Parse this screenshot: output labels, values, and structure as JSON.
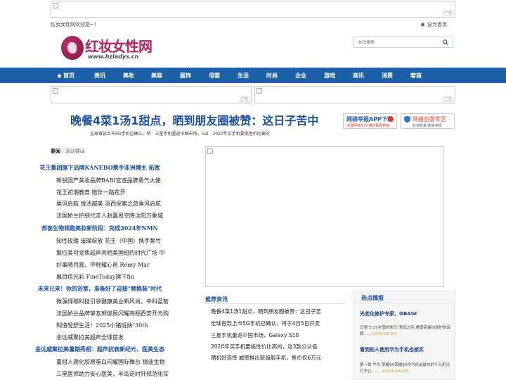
{
  "site": {
    "welcome": "红妆女性网欢迎您~！",
    "set_home": "设为首页",
    "logo_cn": "红妆女性网",
    "logo_en": "www.hzladys.cn"
  },
  "ads": {
    "tag": "广告"
  },
  "search": {
    "placeholder": "本站搜索"
  },
  "nav": {
    "items": [
      "首页",
      "资讯",
      "美妆",
      "美容",
      "服饰",
      "母婴",
      "生活",
      "时尚",
      "企业",
      "游戏",
      "商讯",
      "消费",
      "奢商"
    ]
  },
  "headline": {
    "title": "晚餐4菜1汤1甜点，晒到朋友圈被赞：这日子苦中",
    "subtitle": "全球首款上市5G手机已确认，将　三星手机重返中国市场，Gal　2020年买手机要挑性价比高的"
  },
  "badges": {
    "app_title": "网络举报APP下载",
    "app_sub": "清理网络空间 维护网民权益",
    "zone_title": "网络监督专区",
    "zone_sub": "欢迎监督 能获举报"
  },
  "news": {
    "title": "要闻",
    "sep": "|",
    "scroll": "滚动要闻",
    "items": [
      {
        "text": "花王集团旗下品牌KANEBO携手亚洲博主 拓宽",
        "highlight": true
      },
      {
        "text": "新锐国产美妆品牌BABI官宣品牌勇气大使",
        "highlight": false
      },
      {
        "text": "花王初潮教育 陪伴一路花开",
        "highlight": false
      },
      {
        "text": "乘风启航 悦活越美 羽西探索之旅乘风启航",
        "highlight": false
      },
      {
        "text": "法国娇兰护肤代言人赵露思空降沈阳万象城",
        "highlight": false
      },
      {
        "text": "邦泰生物领跑美妆新阶段：完成2024年NMN",
        "highlight": true
      },
      {
        "text": "知性玫瑰 璀璨绽放 花王（中国）携手紫竹",
        "highlight": false
      },
      {
        "text": "聚拉美可变焦超声亮相美国纽约时代广场 中",
        "highlight": false
      },
      {
        "text": "好事随月圆，中秋耀心邑 Rémy Mar",
        "highlight": false
      },
      {
        "text": "展目信光彩 FineToday旗下fin",
        "highlight": false
      },
      {
        "text": "未来已来！你的浴室，准备好了迎接\"替换装\"时代",
        "highlight": true
      },
      {
        "text": "微藻绿碳科技引领健康美业新风尚，中科蓝智",
        "highlight": false
      },
      {
        "text": "法国娇兰品牌挚友郭俊辰闪耀亮相西安开元购",
        "highlight": false
      },
      {
        "text": "制造轻舒生活！2025小猪班纳\"30th",
        "highlight": false
      },
      {
        "text": "金达威聚拉美超声全球首发",
        "highlight": false
      },
      {
        "text": "金达威聚拉美暑期秀相：超声抗衰新纪元，医美生态",
        "highlight": true
      },
      {
        "text": "重组人源化胶原蛋白闪耀国际舞台 锦波生物",
        "highlight": false
      },
      {
        "text": "三星医师助力安心医美，半岛逆时针规范化实",
        "highlight": false
      }
    ]
  },
  "recommend": {
    "title": "推荐资讯",
    "items": [
      "晚餐4菜1汤1甜点，晒到朋友圈被赞：这日子苦",
      "全球首款上市5G手机已确认，将于4月5日开卖",
      "三星手机重返中国市场，Galaxy S10",
      "2020年买手机要挑性价比高的，这3款公认值",
      "晒机好选择 威图推出新旗舰手机，售价仅6万元"
    ]
  },
  "hot": {
    "title": "热点播报",
    "items": [
      {
        "head": "光老化修护专家，OBAGI",
        "body": "正值\"5.25全国护肤日\"来临之际,美国高端功效护肤品牌……",
        "date": "[2020-05-20]"
      },
      {
        "head": "看到别人使用华为手机也想买",
        "body": "第一款 华为 荣耀9X荣耀9X作为目前最热的千元机当仁不让，……",
        "date": "[2020-04-20]"
      }
    ]
  },
  "colors": {
    "nav_bg": "#1c5fa8",
    "accent_blue": "#1a4f9c",
    "brand_magenta": "#b4235e",
    "date_orange": "#e29c2a"
  }
}
